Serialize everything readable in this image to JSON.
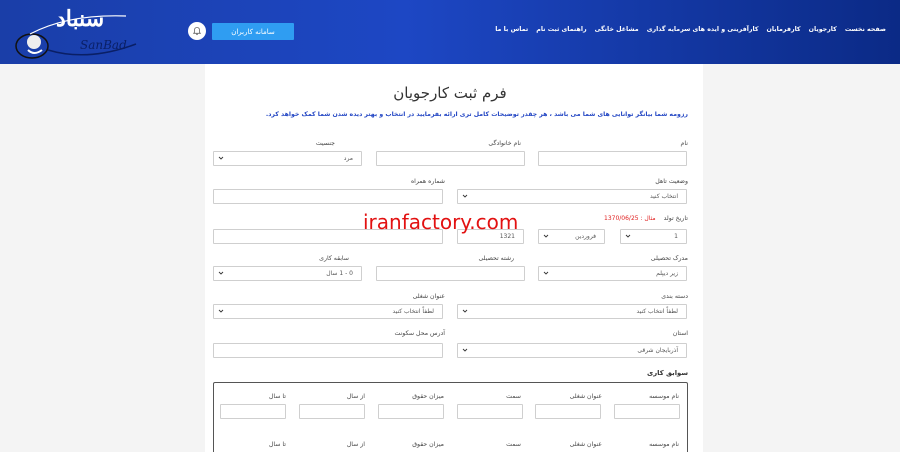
{
  "header": {
    "logo_text": "سنباد",
    "logo_sub": "SanBad",
    "system_button": "سامانه کاربران",
    "nav": [
      "صفحه نخست",
      "کارجویان",
      "کارفرمایان",
      "کارآفرینی و ایده های سرمایه گذاری",
      "مشاغل خانگی",
      "راهنمای ثبت نام",
      "تماس با ما"
    ]
  },
  "page": {
    "title": "فرم ثبت کارجویان",
    "intro": "رزومه شما بیانگر توانایی های شما می باشد ، هر چقدر توضیحات کامل تری ارائه بفرمایید در انتخاب و بهتر دیده شدن شما کمک خواهد کرد."
  },
  "form": {
    "name_label": "نام",
    "family_label": "نام خانوادگی",
    "gender_label": "جنسیت",
    "gender_value": "مرد",
    "marital_label": "وضعیت تاهل",
    "marital_value": "انتخاب کنید",
    "mobile_label": "شماره همراه",
    "birth_label": "تاریخ تولد",
    "birth_example": "مثال : 1370/06/25",
    "birth_day": "1",
    "birth_month": "فروردین",
    "birth_year": "1321",
    "degree_label": "مدرک تحصیلی",
    "degree_value": "زیر دیپلم",
    "major_label": "رشته تحصیلی",
    "experience_label": "سابقه کاری",
    "experience_value": "0 - 1 سال",
    "category_label": "دسته بندی",
    "category_value": "لطفاً انتخاب کنید",
    "job_title_label": "عنوان شغلی",
    "job_title_value": "لطفاً انتخاب کنید",
    "province_label": "استان",
    "province_value": "آذربایجان شرقی",
    "address_label": "آدرس محل سکونت"
  },
  "work_history": {
    "title": "سوابق کاری",
    "columns": [
      "نام موسسه",
      "عنوان شغلی",
      "سمت",
      "میزان حقوق",
      "از سال",
      "تا سال"
    ]
  },
  "watermark": "iranfactory.com"
}
